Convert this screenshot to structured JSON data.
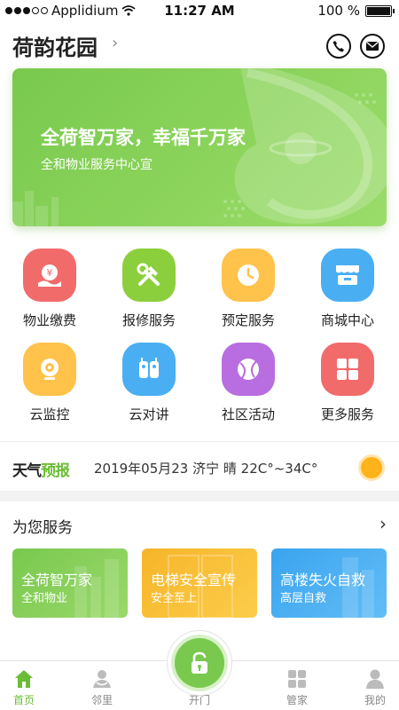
{
  "status_bar": {
    "carrier": "Applidium",
    "time": "11:27 AM",
    "battery": "100 %",
    "battery_level": 1.0
  },
  "header": {
    "title": "荷韵花园",
    "icons": [
      "chevron-right-icon",
      "phone-icon",
      "mail-icon"
    ]
  },
  "banner": {
    "title": "全荷智万家，幸福千万家",
    "subtitle": "全和物业服务中心宣"
  },
  "grid": [
    {
      "label": "物业缴费",
      "icon": "payment-icon",
      "color": "#f26b6b"
    },
    {
      "label": "报修服务",
      "icon": "repair-tools-icon",
      "color": "#8ccf3c"
    },
    {
      "label": "预定服务",
      "icon": "clock-icon",
      "color": "#ffc24a"
    },
    {
      "label": "商城中心",
      "icon": "shop-icon",
      "color": "#4aaef2"
    },
    {
      "label": "云监控",
      "icon": "camera-icon",
      "color": "#ffc24a"
    },
    {
      "label": "云对讲",
      "icon": "intercom-icon",
      "color": "#4aaef2"
    },
    {
      "label": "社区活动",
      "icon": "ball-icon",
      "color": "#b86de0"
    },
    {
      "label": "更多服务",
      "icon": "grid-icon",
      "color": "#f26b6b"
    }
  ],
  "weather": {
    "logo_black": "天气",
    "logo_green": "预报",
    "text": "2019年05月23  济宁  晴 22C°~34C°",
    "icon": "sun-icon"
  },
  "services": {
    "heading": "为您服务",
    "cards": [
      {
        "title": "全荷智万家",
        "subtitle": "全和物业",
        "color": "#8bd45a"
      },
      {
        "title": "电梯安全宣传",
        "subtitle": "安全至上",
        "color": "#fbc33a"
      },
      {
        "title": "高楼失火自救",
        "subtitle": "高层自救",
        "color": "#4aaef2"
      }
    ]
  },
  "tabbar": [
    {
      "label": "首页",
      "icon": "home-icon",
      "active": true
    },
    {
      "label": "邻里",
      "icon": "neighbors-icon",
      "active": false
    },
    {
      "label": "开门",
      "icon": "unlock-icon",
      "active": false
    },
    {
      "label": "管家",
      "icon": "butler-icon",
      "active": false
    },
    {
      "label": "我的",
      "icon": "profile-icon",
      "active": false
    }
  ],
  "colors": {
    "accent": "#79c94e"
  }
}
